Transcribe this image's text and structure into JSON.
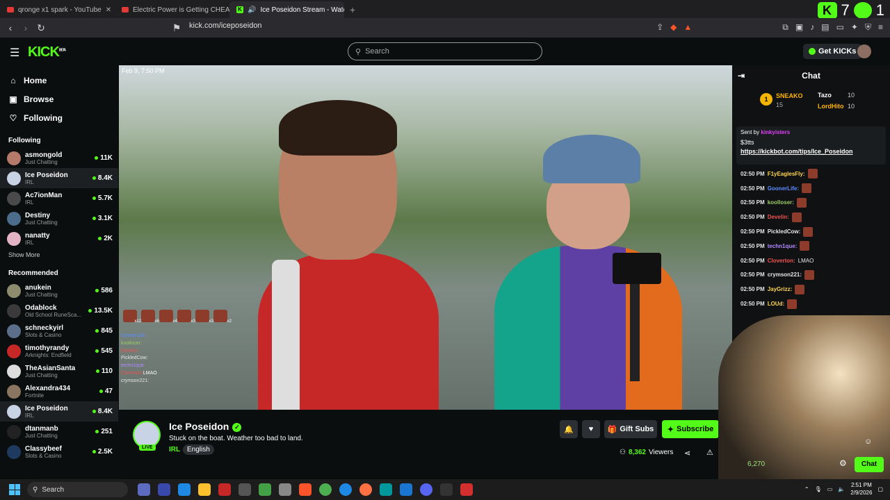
{
  "tabs": [
    {
      "title": "qronge x1 spark - YouTube"
    },
    {
      "title": "Electric Power is Getting CHEAP - Q"
    },
    {
      "title": "Ice Poseidon Stream - Watch"
    }
  ],
  "ext": {
    "k_count": "7",
    "p_count": "1"
  },
  "address": {
    "url": "kick.com/iceposeidon"
  },
  "header": {
    "logo": "KICK",
    "logo_sup": "BETA",
    "search_placeholder": "Search",
    "get_kicks": "Get KICKs"
  },
  "nav": [
    {
      "label": "Home",
      "icon": "home-icon"
    },
    {
      "label": "Browse",
      "icon": "browse-icon"
    },
    {
      "label": "Following",
      "icon": "heart-icon"
    }
  ],
  "following_label": "Following",
  "following": [
    {
      "name": "asmongold",
      "cat": "Just Chatting",
      "viewers": "11K",
      "color": "#b57a6a"
    },
    {
      "name": "Ice Poseidon",
      "cat": "IRL",
      "viewers": "8.4K",
      "color": "#c9d3e6"
    },
    {
      "name": "Ac7ionMan",
      "cat": "IRL",
      "viewers": "5.7K",
      "color": "#4a4a4a"
    },
    {
      "name": "Destiny",
      "cat": "Just Chatting",
      "viewers": "3.1K",
      "color": "#4b6c8a"
    },
    {
      "name": "nanatty",
      "cat": "IRL",
      "viewers": "2K",
      "color": "#e2b3c2"
    }
  ],
  "show_more": "Show More",
  "recommended_label": "Recommended",
  "recommended": [
    {
      "name": "anukein",
      "cat": "Just Chatting",
      "viewers": "586",
      "color": "#8d8d6e"
    },
    {
      "name": "Odablock",
      "cat": "Old School RuneSca...",
      "viewers": "13.5K",
      "color": "#3a3a3a"
    },
    {
      "name": "schneckyirl",
      "cat": "Slots & Casino",
      "viewers": "845",
      "color": "#5c6f8a"
    },
    {
      "name": "timothyrandy",
      "cat": "Arknights: Endfield",
      "viewers": "545",
      "color": "#c62828"
    },
    {
      "name": "TheAsianSanta",
      "cat": "Just Chatting",
      "viewers": "110",
      "color": "#ddd"
    },
    {
      "name": "Alexandra434",
      "cat": "Fortnite",
      "viewers": "47",
      "color": "#8a7560"
    },
    {
      "name": "Ice Poseidon",
      "cat": "IRL",
      "viewers": "8.4K",
      "color": "#c9d3e6"
    },
    {
      "name": "dtanmanb",
      "cat": "Just Chatting",
      "viewers": "251",
      "color": "#222"
    },
    {
      "name": "Classybeef",
      "cat": "Slots & Casino",
      "viewers": "2.5K",
      "color": "#1e3a5f"
    }
  ],
  "video": {
    "date": "Feb 9, 7:50 PM",
    "emotes": [
      "x12",
      "x6",
      "x4",
      "x3",
      "x3",
      "x2"
    ],
    "overlay_chat": [
      {
        "user": "GoonerLife:",
        "color": "#5c8cff"
      },
      {
        "user": "koolloser:",
        "color": "#9ccc65"
      },
      {
        "user": "Develin:",
        "color": "#ef5350"
      },
      {
        "user": "PickledCow:",
        "color": "#e6e6e6"
      },
      {
        "user": "techn1que:",
        "color": "#b388ff"
      },
      {
        "user": "Cloverton:",
        "color": "#ef5350",
        "text": "LMAO"
      },
      {
        "user": "crymson221:",
        "color": "#e6e6e6"
      }
    ]
  },
  "stream": {
    "name": "Ice Poseidon",
    "live": "LIVE",
    "title": "Stuck on the boat. Weather too bad to land.",
    "category": "IRL",
    "language": "English",
    "gift_subs": "Gift Subs",
    "subscribe": "Subscribe",
    "viewers": "8,362",
    "viewers_label": "Viewers"
  },
  "chat": {
    "title": "Chat",
    "leader1": {
      "rank": "1",
      "name": "SNEAKO",
      "amount": "15"
    },
    "leader2": {
      "name": "Tazo",
      "amount": "10"
    },
    "leader3": {
      "name": "LordHito",
      "amount": "10"
    },
    "pinned": {
      "sent_by": "Sent by",
      "user": "kinkyisters",
      "amount": "$3tts",
      "link": "https://kickbot.com/tips/Ice_Poseidon"
    },
    "messages": [
      {
        "time": "02:50 PM",
        "user": "F1yEaglesFly:",
        "color": "#ffd54f",
        "text": ""
      },
      {
        "time": "02:50 PM",
        "user": "GoonerLife:",
        "color": "#5c8cff",
        "text": ""
      },
      {
        "time": "02:50 PM",
        "user": "koolloser:",
        "color": "#9ccc65",
        "text": ""
      },
      {
        "time": "02:50 PM",
        "user": "Develin:",
        "color": "#ef5350",
        "text": ""
      },
      {
        "time": "02:50 PM",
        "user": "PickledCow:",
        "color": "#e6e6e6",
        "text": ""
      },
      {
        "time": "02:50 PM",
        "user": "techn1que:",
        "color": "#b388ff",
        "text": ""
      },
      {
        "time": "02:50 PM",
        "user": "Cloverton:",
        "color": "#ef5350",
        "text": "LMAO"
      },
      {
        "time": "02:50 PM",
        "user": "crymson221:",
        "color": "#e6e6e6",
        "text": ""
      },
      {
        "time": "02:50 PM",
        "user": "JayGrizz:",
        "color": "#ffd54f",
        "text": ""
      },
      {
        "time": "02:50 PM",
        "user": "LOUd:",
        "color": "#ffd54f",
        "text": ""
      }
    ],
    "views_badge": "6,270",
    "chat_button": "Chat"
  },
  "taskbar": {
    "search": "Search",
    "time": "2:51 PM",
    "date": "2/9/2026"
  },
  "colors": {
    "accent": "#53fc18",
    "bg": "#0b0e0f"
  }
}
